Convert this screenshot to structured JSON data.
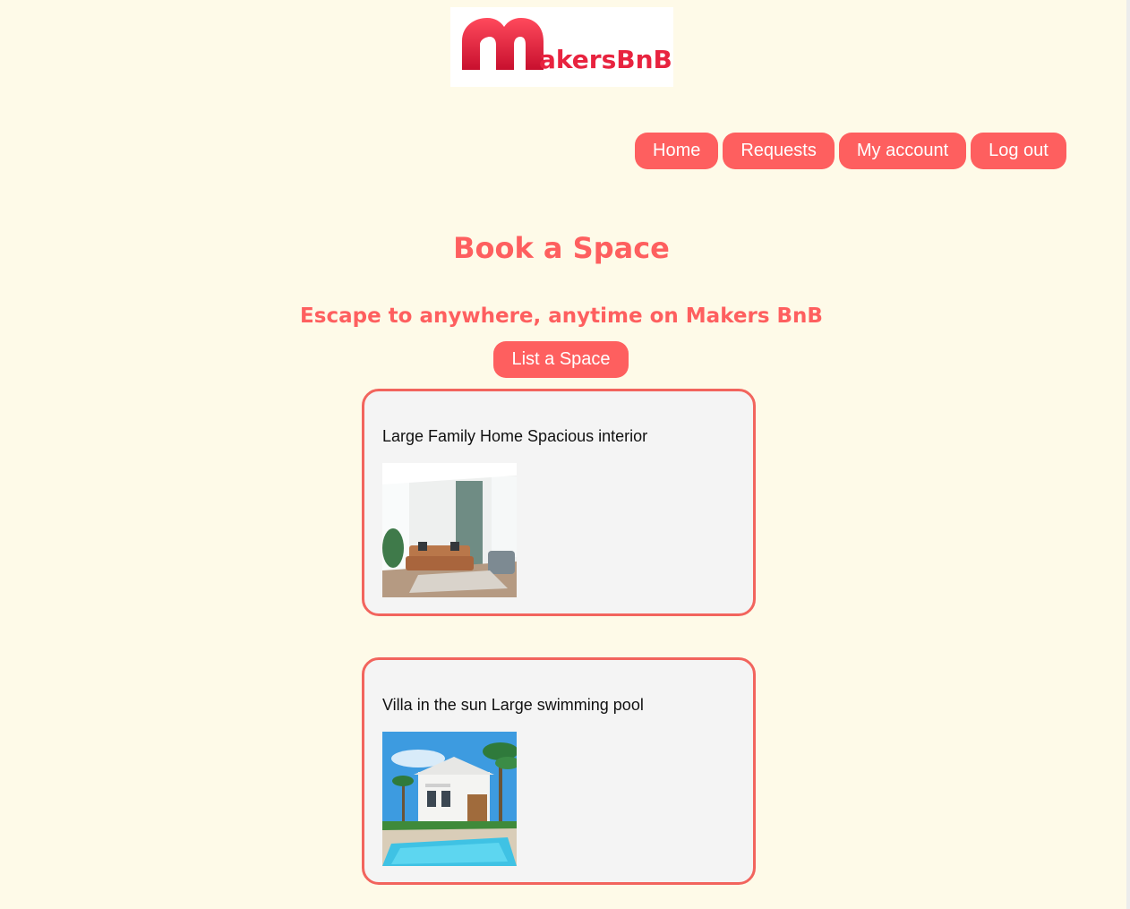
{
  "header": {
    "logo_text": "akersBnB"
  },
  "nav": {
    "items": [
      {
        "label": "Home"
      },
      {
        "label": "Requests"
      },
      {
        "label": "My account"
      },
      {
        "label": "Log out"
      }
    ]
  },
  "main": {
    "title": "Book a Space",
    "subtitle": "Escape to anywhere, anytime on Makers BnB",
    "list_button_label": "List a Space"
  },
  "spaces": [
    {
      "title": "Large Family Home Spacious interior",
      "image": "living-room-photo"
    },
    {
      "title": "Villa in the sun Large swimming pool",
      "image": "villa-pool-photo"
    }
  ],
  "colors": {
    "background": "#fefae8",
    "accent": "#fe5f5f",
    "card_border": "#f2645d",
    "card_background": "#f4f4f4",
    "logo_red": "#e8233f"
  }
}
